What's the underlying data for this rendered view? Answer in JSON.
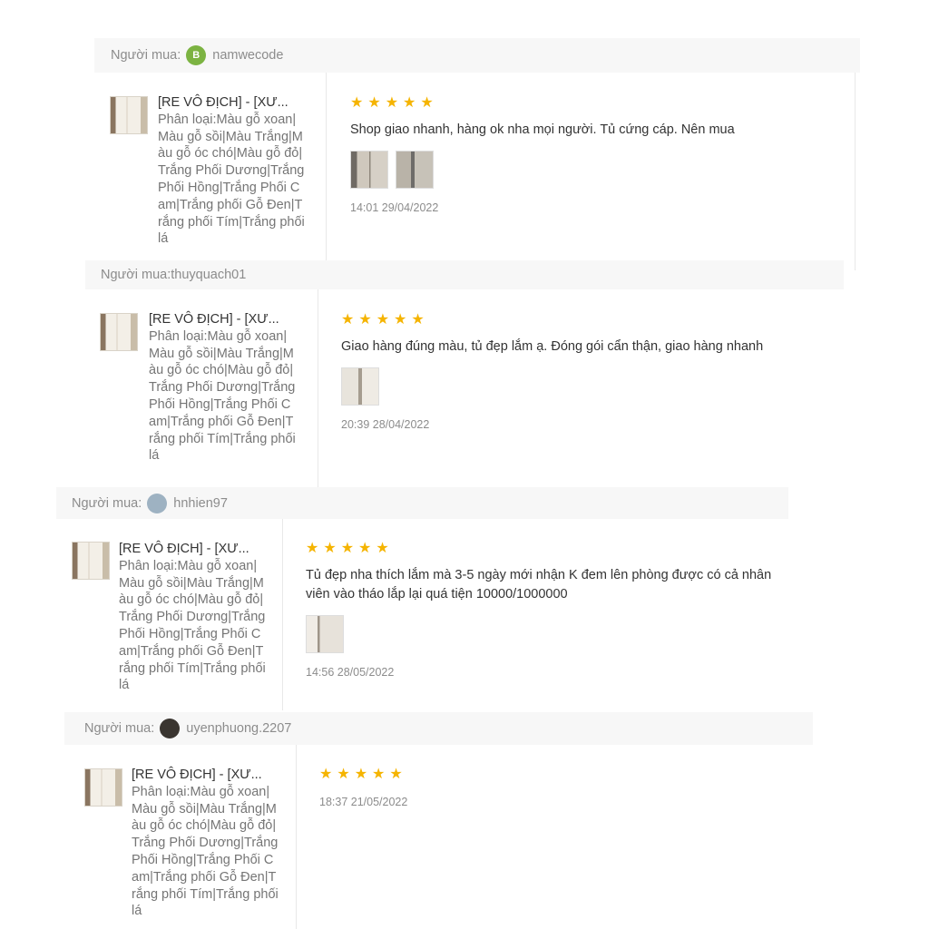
{
  "reviews": [
    {
      "buyer_prefix": "Người mua:",
      "buyer_name": "namwecode",
      "avatar_letter": "B",
      "avatar_color": "#7cb342",
      "product_title": "[RE VÔ ĐỊCH] - [XƯ...",
      "product_variant": "Phân loại:Màu gỗ xoan|Màu gỗ sồi|Màu Trắng|Màu gỗ óc chó|Màu gỗ đỏ|Trắng Phối Dương|Trắng Phối Hồng|Trắng Phối Cam|Trắng phối Gỗ Đen|Trắng phối Tím|Trắng phối lá",
      "rating": 5,
      "comment": "Shop giao nhanh, hàng ok nha mọi người. Tủ cứng cáp. Nên mua",
      "photo_count": 2,
      "timestamp": "14:01 29/04/2022"
    },
    {
      "buyer_prefix": "Người mua:",
      "buyer_name": "thuyquach01",
      "avatar_letter": "",
      "avatar_color": "",
      "product_title": "[RE VÔ ĐỊCH] - [XƯ...",
      "product_variant": "Phân loại:Màu gỗ xoan|Màu gỗ sồi|Màu Trắng|Màu gỗ óc chó|Màu gỗ đỏ|Trắng Phối Dương|Trắng Phối Hồng|Trắng Phối Cam|Trắng phối Gỗ Đen|Trắng phối Tím|Trắng phối lá",
      "rating": 5,
      "comment": "Giao hàng đúng màu, tủ đẹp lắm ạ. Đóng gói cẩn thận, giao hàng nhanh",
      "photo_count": 1,
      "timestamp": "20:39 28/04/2022"
    },
    {
      "buyer_prefix": "Người mua:",
      "buyer_name": "hnhien97",
      "avatar_letter": "",
      "avatar_color": "#9eb2c2",
      "product_title": "[RE VÔ ĐỊCH] - [XƯ...",
      "product_variant": "Phân loại:Màu gỗ xoan|Màu gỗ sồi|Màu Trắng|Màu gỗ óc chó|Màu gỗ đỏ|Trắng Phối Dương|Trắng Phối Hồng|Trắng Phối Cam|Trắng phối Gỗ Đen|Trắng phối Tím|Trắng phối lá",
      "rating": 5,
      "comment": "Tủ đẹp nha thích lắm mà 3-5 ngày mới nhận K đem lên phòng được có cả nhân viên vào tháo lắp lại quá tiện 10000/1000000",
      "photo_count": 1,
      "timestamp": "14:56 28/05/2022"
    },
    {
      "buyer_prefix": "Người mua:",
      "buyer_name": "uyenphuong.2207",
      "avatar_letter": "",
      "avatar_color": "#3a3530",
      "product_title": "[RE VÔ ĐỊCH] - [XƯ...",
      "product_variant": "Phân loại:Màu gỗ xoan|Màu gỗ sồi|Màu Trắng|Màu gỗ óc chó|Màu gỗ đỏ|Trắng Phối Dương|Trắng Phối Hồng|Trắng Phối Cam|Trắng phối Gỗ Đen|Trắng phối Tím|Trắng phối lá",
      "rating": 5,
      "comment": "",
      "photo_count": 0,
      "timestamp": "18:37 21/05/2022"
    }
  ]
}
